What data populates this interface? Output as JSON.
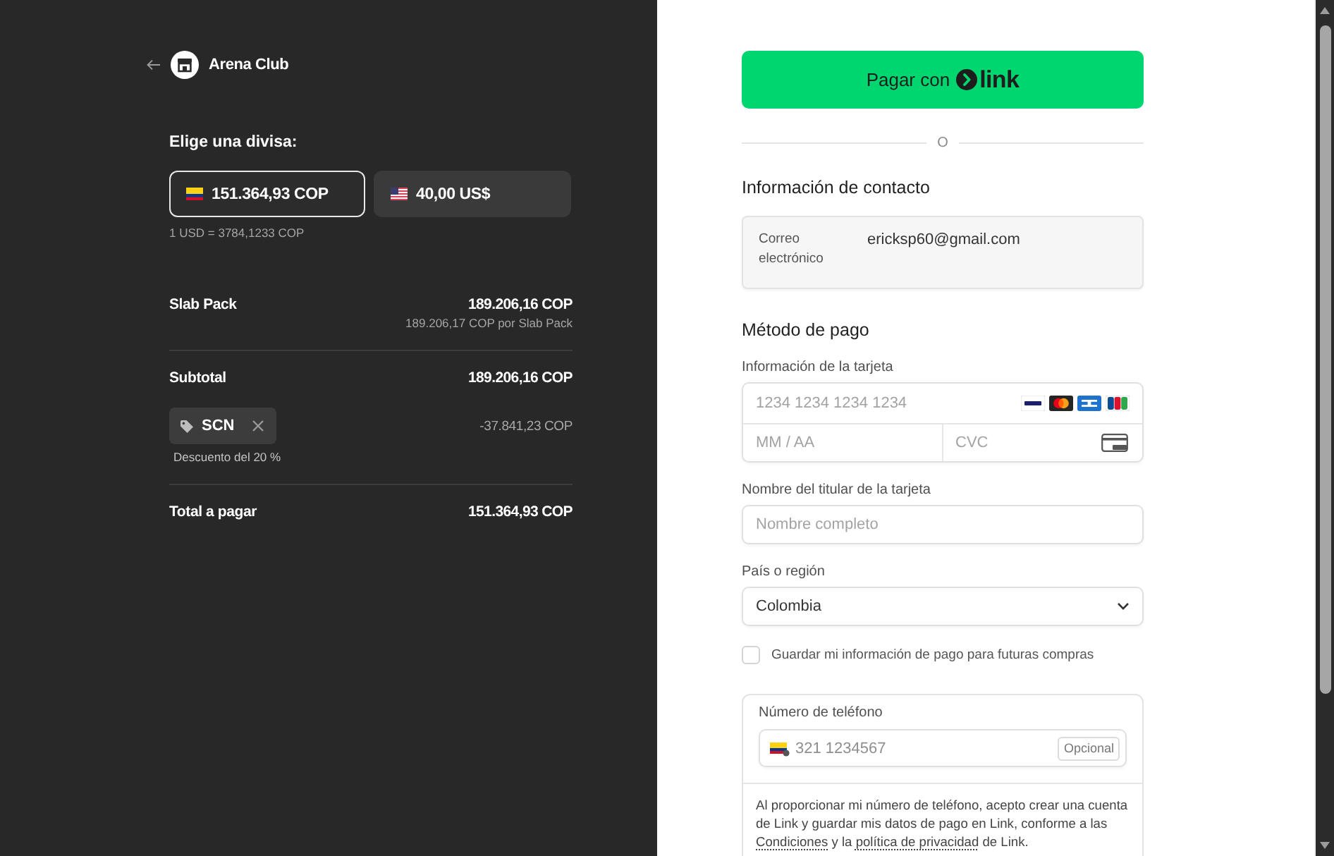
{
  "brand": {
    "name": "Arena Club"
  },
  "currency": {
    "title": "Elige una divisa:",
    "options": [
      {
        "label": "151.364,93 COP",
        "kind": "cop",
        "selected": true
      },
      {
        "label": "40,00 US$",
        "kind": "usd",
        "selected": false
      }
    ],
    "rate": "1 USD = 3784,1233 COP"
  },
  "summary": {
    "items": [
      {
        "name": "Slab Pack",
        "amount": "189.206,16 COP",
        "unit_price": "189.206,17 COP por Slab Pack"
      }
    ],
    "subtotal": {
      "label": "Subtotal",
      "amount": "189.206,16 COP"
    },
    "promo": {
      "code": "SCN",
      "description": "Descuento del 20 %",
      "amount": "-37.841,23 COP"
    },
    "total": {
      "label": "Total a pagar",
      "amount": "151.364,93 COP"
    }
  },
  "link_button": {
    "label": "Pagar con",
    "brand": "link"
  },
  "divider_text": "O",
  "contact": {
    "title": "Información de contacto",
    "email_label": "Correo electrónico",
    "email": "ericksp60@gmail.com"
  },
  "payment": {
    "title": "Método de pago",
    "card": {
      "label": "Información de la tarjeta",
      "number_placeholder": "1234 1234 1234 1234",
      "expiry_placeholder": "MM / AA",
      "cvc_placeholder": "CVC"
    },
    "cardholder": {
      "label": "Nombre del titular de la tarjeta",
      "placeholder": "Nombre completo"
    },
    "country": {
      "label": "País o región",
      "value": "Colombia"
    },
    "save": {
      "label": "Guardar mi información de pago para futuras compras",
      "checked": false
    }
  },
  "phone": {
    "label": "Número de teléfono",
    "placeholder": "321 1234567",
    "badge": "Opcional",
    "terms": [
      {
        "kind": "text",
        "text": "Al proporcionar mi número de teléfono, acepto crear una cuenta de Link y guardar mis datos de pago en Link, conforme a las "
      },
      {
        "kind": "link",
        "text": "Condiciones"
      },
      {
        "kind": "text",
        "text": " y la "
      },
      {
        "kind": "link",
        "text": "política de privacidad"
      },
      {
        "kind": "text",
        "text": " de Link."
      }
    ]
  }
}
